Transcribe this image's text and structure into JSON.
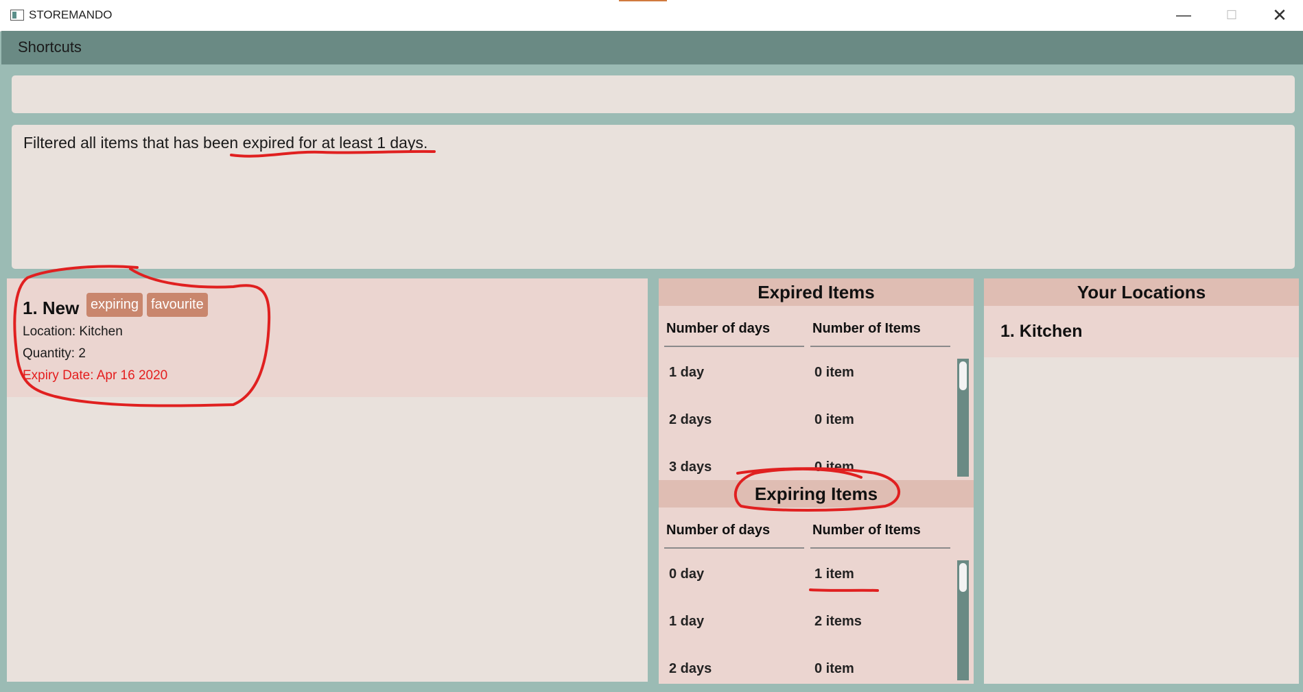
{
  "window": {
    "title": "STOREMANDO",
    "minimize_glyph": "—",
    "maximize_glyph": "☐",
    "close_glyph": "✕"
  },
  "menu": {
    "label": "Shortcuts"
  },
  "command": {
    "value": ""
  },
  "result": {
    "text": "Filtered all items that has been expired for at least 1 days."
  },
  "items": [
    {
      "name": "1. New",
      "tags": [
        "expiring",
        "favourite"
      ],
      "location": "Location: Kitchen",
      "quantity": "Quantity: 2",
      "expiry": "Expiry Date: Apr 16 2020"
    }
  ],
  "expired_panel": {
    "title": "Expired Items",
    "col_days": "Number of days",
    "col_items": "Number of Items",
    "rows": [
      {
        "days": "1 day",
        "items": "0 item"
      },
      {
        "days": "2 days",
        "items": "0 item"
      },
      {
        "days": "3 days",
        "items": "0 item"
      }
    ]
  },
  "expiring_panel": {
    "title": "Expiring Items",
    "col_days": "Number of days",
    "col_items": "Number of Items",
    "rows": [
      {
        "days": "0 day",
        "items": "1 item"
      },
      {
        "days": "1 day",
        "items": "2 items"
      },
      {
        "days": "2 days",
        "items": "0 item"
      }
    ]
  },
  "locations_panel": {
    "title": "Your Locations",
    "items": [
      "1. Kitchen"
    ]
  },
  "colors": {
    "annotation": "#e02020",
    "expiry_text": "#e41e1e",
    "tag": "#c9866d",
    "header": "#6a8a84"
  }
}
